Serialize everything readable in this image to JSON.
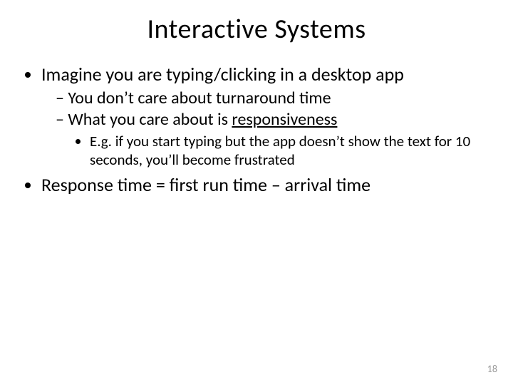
{
  "title": "Interactive Systems",
  "bullets": {
    "b1": "Imagine you are typing/clicking in a desktop app",
    "b1_s1": "You don’t care about turnaround time",
    "b1_s2_pre": "What you care about is ",
    "b1_s2_u": "responsiveness",
    "b1_s2_eg": "E.g. if you start typing but the app doesn’t show the text for 10 seconds, you’ll become frustrated",
    "b2": "Response time = first run time – arrival time"
  },
  "page_number": "18"
}
